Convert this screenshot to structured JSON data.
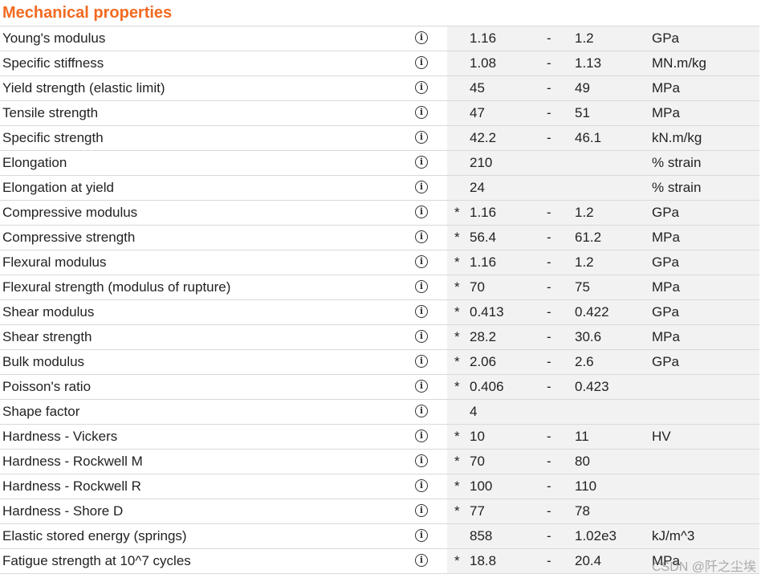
{
  "section_title": "Mechanical properties",
  "info_icon": "info-circle-icon",
  "dash": "-",
  "watermark": "CSDN @阡之尘埃",
  "rows": [
    {
      "name": "Young's modulus",
      "star": "",
      "low": "1.16",
      "high": "1.2",
      "unit": "GPa"
    },
    {
      "name": "Specific stiffness",
      "star": "",
      "low": "1.08",
      "high": "1.13",
      "unit": "MN.m/kg"
    },
    {
      "name": "Yield strength (elastic limit)",
      "star": "",
      "low": "45",
      "high": "49",
      "unit": "MPa"
    },
    {
      "name": "Tensile strength",
      "star": "",
      "low": "47",
      "high": "51",
      "unit": "MPa"
    },
    {
      "name": "Specific strength",
      "star": "",
      "low": "42.2",
      "high": "46.1",
      "unit": "kN.m/kg"
    },
    {
      "name": "Elongation",
      "star": "",
      "low": "210",
      "high": "",
      "unit": "% strain"
    },
    {
      "name": "Elongation at yield",
      "star": "",
      "low": "24",
      "high": "",
      "unit": "% strain"
    },
    {
      "name": "Compressive modulus",
      "star": "*",
      "low": "1.16",
      "high": "1.2",
      "unit": "GPa"
    },
    {
      "name": "Compressive strength",
      "star": "*",
      "low": "56.4",
      "high": "61.2",
      "unit": "MPa"
    },
    {
      "name": "Flexural modulus",
      "star": "*",
      "low": "1.16",
      "high": "1.2",
      "unit": "GPa"
    },
    {
      "name": "Flexural strength (modulus of rupture)",
      "star": "*",
      "low": "70",
      "high": "75",
      "unit": "MPa"
    },
    {
      "name": "Shear modulus",
      "star": "*",
      "low": "0.413",
      "high": "0.422",
      "unit": "GPa"
    },
    {
      "name": "Shear strength",
      "star": "*",
      "low": "28.2",
      "high": "30.6",
      "unit": "MPa"
    },
    {
      "name": "Bulk modulus",
      "star": "*",
      "low": "2.06",
      "high": "2.6",
      "unit": "GPa"
    },
    {
      "name": "Poisson's ratio",
      "star": "*",
      "low": "0.406",
      "high": "0.423",
      "unit": ""
    },
    {
      "name": "Shape factor",
      "star": "",
      "low": "4",
      "high": "",
      "unit": ""
    },
    {
      "name": "Hardness - Vickers",
      "star": "*",
      "low": "10",
      "high": "11",
      "unit": "HV"
    },
    {
      "name": "Hardness - Rockwell M",
      "star": "*",
      "low": "70",
      "high": "80",
      "unit": ""
    },
    {
      "name": "Hardness - Rockwell R",
      "star": "*",
      "low": "100",
      "high": "110",
      "unit": ""
    },
    {
      "name": "Hardness - Shore D",
      "star": "*",
      "low": "77",
      "high": "78",
      "unit": ""
    },
    {
      "name": "Elastic stored energy (springs)",
      "star": "",
      "low": "858",
      "high": "1.02e3",
      "unit": "kJ/m^3"
    },
    {
      "name": "Fatigue strength at 10^7 cycles",
      "star": "*",
      "low": "18.8",
      "high": "20.4",
      "unit": "MPa"
    }
  ]
}
